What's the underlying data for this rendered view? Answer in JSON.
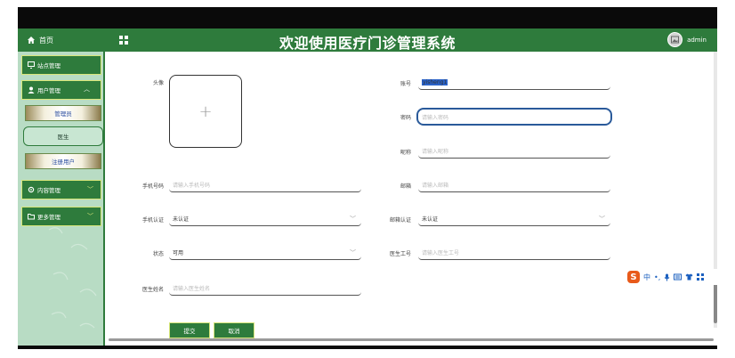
{
  "header": {
    "home_label": "首页",
    "title": "欢迎使用医疗门诊管理系统",
    "username": "admin"
  },
  "sidebar": {
    "items": [
      {
        "label": "站点管理"
      },
      {
        "label": "用户管理"
      },
      {
        "label": "内容管理"
      },
      {
        "label": "更多管理"
      }
    ],
    "sub_items": [
      {
        "label": "管理员"
      },
      {
        "label": "医生"
      },
      {
        "label": "注册用户"
      }
    ]
  },
  "form": {
    "avatar_label": "头像",
    "upload_plus": "+",
    "account": {
      "label": "账号",
      "value": "yisheng1"
    },
    "password": {
      "label": "密码",
      "placeholder": "请输入密码"
    },
    "nickname": {
      "label": "昵称",
      "placeholder": "请输入昵称"
    },
    "phone": {
      "label": "手机号码",
      "placeholder": "请输入手机号码"
    },
    "email": {
      "label": "邮箱",
      "placeholder": "请输入邮箱"
    },
    "phone_verify": {
      "label": "手机认证",
      "value": "未认证"
    },
    "email_verify": {
      "label": "邮箱认证",
      "value": "未认证"
    },
    "status": {
      "label": "状态",
      "value": "可用"
    },
    "doctor_no": {
      "label": "医生工号",
      "placeholder": "请输入医生工号"
    },
    "doctor_name": {
      "label": "医生姓名",
      "placeholder": "请输入医生姓名"
    },
    "submit_label": "提交",
    "cancel_label": "取消"
  },
  "ime": {
    "mode": "中",
    "punct": "•,"
  },
  "colors": {
    "brand_green": "#2e7b3c",
    "sidebar_bg": "#b8dcc4",
    "accent_yellow": "#d8e67a",
    "focus_blue": "#2a5a9a"
  }
}
